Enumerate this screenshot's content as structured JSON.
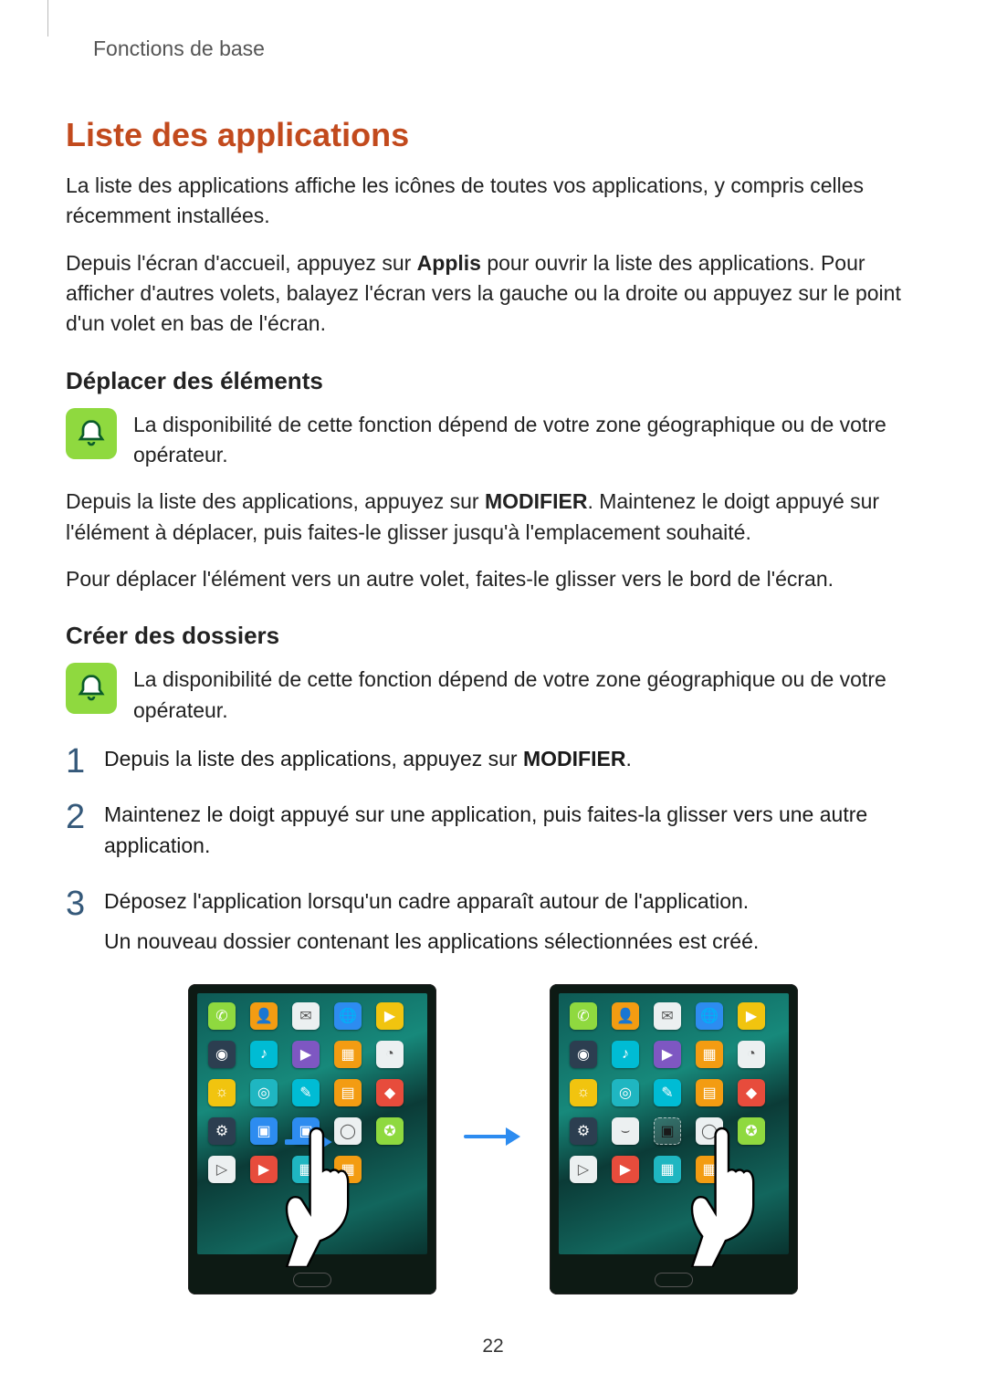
{
  "breadcrumb": "Fonctions de base",
  "title": "Liste des applications",
  "intro1": "La liste des applications affiche les icônes de toutes vos applications, y compris celles récemment installées.",
  "intro2_a": "Depuis l'écran d'accueil, appuyez sur ",
  "intro2_bold": "Applis",
  "intro2_b": " pour ouvrir la liste des applications. Pour afficher d'autres volets, balayez l'écran vers la gauche ou la droite ou appuyez sur le point d'un volet en bas de l'écran.",
  "section_move": {
    "title": "Déplacer des éléments",
    "note": "La disponibilité de cette fonction dépend de votre zone géographique ou de votre opérateur.",
    "p1_a": "Depuis la liste des applications, appuyez sur ",
    "p1_bold": "MODIFIER",
    "p1_b": ". Maintenez le doigt appuyé sur l'élément à déplacer, puis faites-le glisser jusqu'à l'emplacement souhaité.",
    "p2": "Pour déplacer l'élément vers un autre volet, faites-le glisser vers le bord de l'écran."
  },
  "section_folders": {
    "title": "Créer des dossiers",
    "note": "La disponibilité de cette fonction dépend de votre zone géographique ou de votre opérateur.",
    "step1_a": "Depuis la liste des applications, appuyez sur ",
    "step1_bold": "MODIFIER",
    "step1_b": ".",
    "step2": "Maintenez le doigt appuyé sur une application, puis faites-la glisser vers une autre application.",
    "step3": "Déposez l'application lorsqu'un cadre apparaît autour de l'application.",
    "step3_extra": "Un nouveau dossier contenant les applications sélectionnées est créé."
  },
  "page_number": "22"
}
